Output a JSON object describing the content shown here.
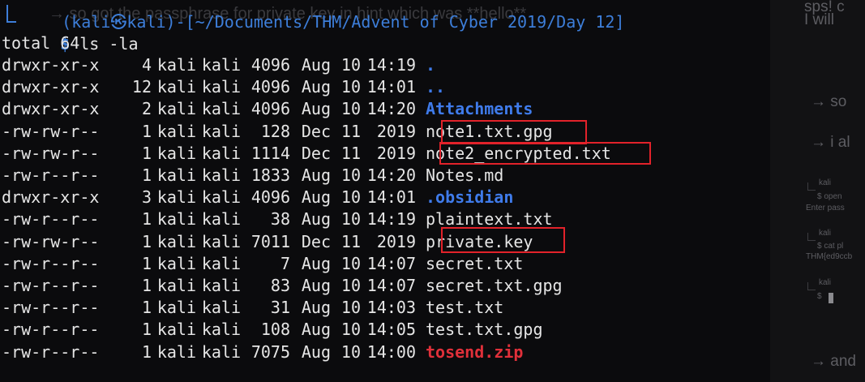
{
  "prompt": {
    "host_line": "(kali㉿kali)-[~/Documents/THM/Advent of Cyber 2019/Day 12]",
    "symbol": "$",
    "command": "ls -la"
  },
  "total_line": "total 64",
  "entries": [
    {
      "perm": "drwxr-xr-x",
      "links": "4",
      "user": "kali",
      "group": "kali",
      "size": "4096",
      "month": "Aug",
      "day": "10",
      "time": "14:19",
      "name": "."
    },
    {
      "perm": "drwxr-xr-x",
      "links": "12",
      "user": "kali",
      "group": "kali",
      "size": "4096",
      "month": "Aug",
      "day": "10",
      "time": "14:01",
      "name": ".."
    },
    {
      "perm": "drwxr-xr-x",
      "links": "2",
      "user": "kali",
      "group": "kali",
      "size": "4096",
      "month": "Aug",
      "day": "10",
      "time": "14:20",
      "name": "Attachments"
    },
    {
      "perm": "-rw-rw-r--",
      "links": "1",
      "user": "kali",
      "group": "kali",
      "size": "128",
      "month": "Dec",
      "day": "11",
      "time": "2019",
      "name": "note1.txt.gpg"
    },
    {
      "perm": "-rw-rw-r--",
      "links": "1",
      "user": "kali",
      "group": "kali",
      "size": "1114",
      "month": "Dec",
      "day": "11",
      "time": "2019",
      "name": "note2_encrypted.txt"
    },
    {
      "perm": "-rw-r--r--",
      "links": "1",
      "user": "kali",
      "group": "kali",
      "size": "1833",
      "month": "Aug",
      "day": "10",
      "time": "14:20",
      "name": "Notes.md"
    },
    {
      "perm": "drwxr-xr-x",
      "links": "3",
      "user": "kali",
      "group": "kali",
      "size": "4096",
      "month": "Aug",
      "day": "10",
      "time": "14:01",
      "name": ".obsidian"
    },
    {
      "perm": "-rw-r--r--",
      "links": "1",
      "user": "kali",
      "group": "kali",
      "size": "38",
      "month": "Aug",
      "day": "10",
      "time": "14:19",
      "name": "plaintext.txt"
    },
    {
      "perm": "-rw-rw-r--",
      "links": "1",
      "user": "kali",
      "group": "kali",
      "size": "7011",
      "month": "Dec",
      "day": "11",
      "time": "2019",
      "name": "private.key"
    },
    {
      "perm": "-rw-r--r--",
      "links": "1",
      "user": "kali",
      "group": "kali",
      "size": "7",
      "month": "Aug",
      "day": "10",
      "time": "14:07",
      "name": "secret.txt"
    },
    {
      "perm": "-rw-r--r--",
      "links": "1",
      "user": "kali",
      "group": "kali",
      "size": "83",
      "month": "Aug",
      "day": "10",
      "time": "14:07",
      "name": "secret.txt.gpg"
    },
    {
      "perm": "-rw-r--r--",
      "links": "1",
      "user": "kali",
      "group": "kali",
      "size": "31",
      "month": "Aug",
      "day": "10",
      "time": "14:03",
      "name": "test.txt"
    },
    {
      "perm": "-rw-r--r--",
      "links": "1",
      "user": "kali",
      "group": "kali",
      "size": "108",
      "month": "Aug",
      "day": "10",
      "time": "14:05",
      "name": "test.txt.gpg"
    },
    {
      "perm": "-rw-r--r--",
      "links": "1",
      "user": "kali",
      "group": "kali",
      "size": "7075",
      "month": "Aug",
      "day": "10",
      "time": "14:00",
      "name": "tosend.zip"
    }
  ],
  "background_text": {
    "top_line": "→ so got the passphrase for private key in hint which was **hello**"
  },
  "ghost_panel": {
    "line1": "sps! c",
    "line2": "I will",
    "arrow1": "→ so",
    "arrow2": "→ i al",
    "small1": "kali",
    "small2": "$ open",
    "small3": "Enter pass",
    "small4": "kali",
    "small5": "$ cat pl",
    "small6": "THM{ed9ccb",
    "small7": "kali",
    "small8": "$",
    "arrow3": "→ and"
  },
  "colors": {
    "directory": "#3f7bea",
    "archive": "#e0303a",
    "highlight_box": "#e2222a",
    "prompt": "#3d7ed9"
  }
}
